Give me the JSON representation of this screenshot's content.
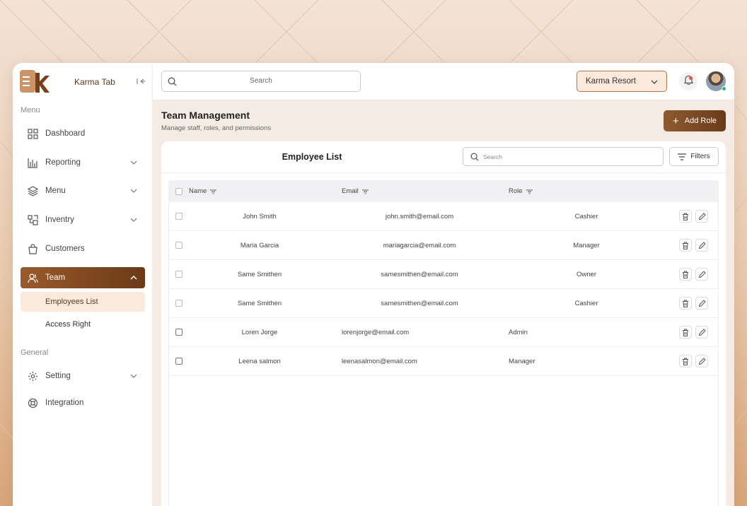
{
  "app": {
    "name": "Karma Tab"
  },
  "sidebar": {
    "menu_label": "Menu",
    "general_label": "General",
    "items": [
      {
        "label": "Dashboard"
      },
      {
        "label": "Reporting"
      },
      {
        "label": "Menu"
      },
      {
        "label": "Inventry"
      },
      {
        "label": "Customers"
      },
      {
        "label": "Team"
      }
    ],
    "team_sub": [
      {
        "label": "Employees List"
      },
      {
        "label": "Access Right"
      }
    ],
    "general_items": [
      {
        "label": "Setting"
      },
      {
        "label": "Integration"
      }
    ]
  },
  "header": {
    "search_placeholder": "Search",
    "resort": "Karma Resort"
  },
  "main": {
    "title": "Team Management",
    "subtitle": "Manage staff, roles, and permissions",
    "add_role_label": "Add Role"
  },
  "card": {
    "title": "Employee List",
    "search_placeholder": "Search",
    "filters_label": "Filters"
  },
  "table": {
    "columns": [
      "Name",
      "Email",
      "Role"
    ],
    "rows": [
      {
        "name": "John Smith",
        "email": "john.smith@email.com",
        "role": "Cashier"
      },
      {
        "name": "Maria Garcia",
        "email": "mariagarcia@email.com",
        "role": "Manager"
      },
      {
        "name": "Same Smithen",
        "email": "samesmithen@email.com",
        "role": "Owner"
      },
      {
        "name": "Same Smithen",
        "email": "samesmithen@email.com",
        "role": "Cashier"
      },
      {
        "name": "Loren Jorge",
        "email": "lorenjorge@email.com",
        "role": "Admin"
      },
      {
        "name": "Leena salmon",
        "email": "leenasalmon@email.com",
        "role": "Manager"
      }
    ]
  },
  "colors": {
    "brand": "#7a4520",
    "accent_bg": "#fbe9dd",
    "status_online": "#2fb86b"
  }
}
